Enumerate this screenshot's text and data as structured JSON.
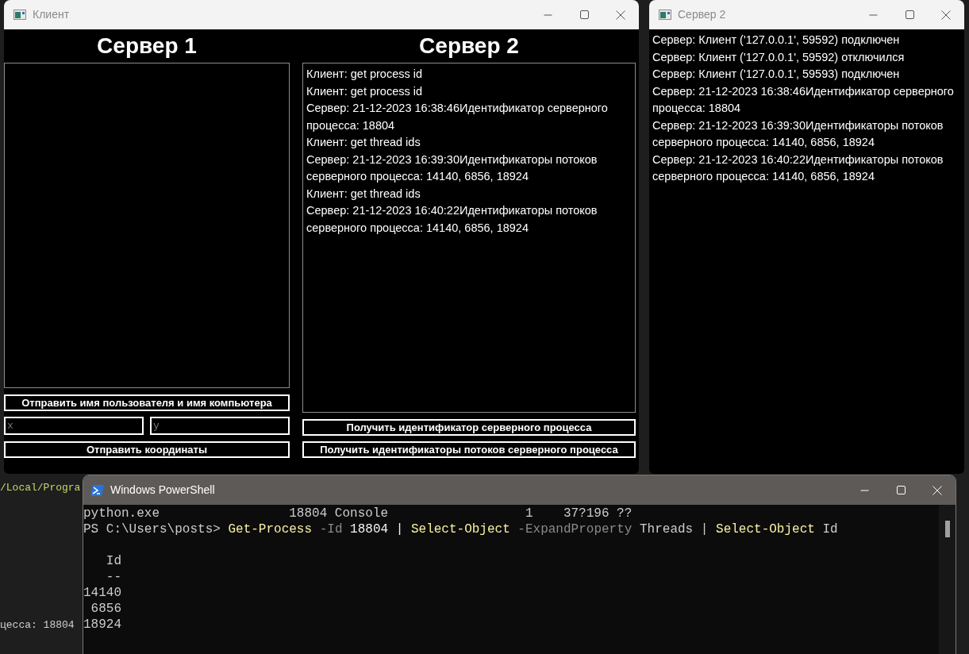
{
  "background_editor": {
    "lines": [
      {
        "text": "/Local/Progra",
        "kind": "path"
      },
      {
        "text": "цесса: 18804",
        "kind": "plain"
      }
    ]
  },
  "client_window": {
    "title": "Клиент",
    "server1": {
      "heading": "Сервер 1",
      "send_user_button": "Отправить имя пользователя и имя компьютера",
      "x_field": {
        "placeholder": "x"
      },
      "y_field": {
        "placeholder": "y"
      },
      "send_coords_button": "Отправить координаты"
    },
    "server2": {
      "heading": "Сервер 2",
      "log": [
        "Клиент: get process id",
        "Клиент: get process id",
        "Сервер: 21-12-2023 16:38:46Идентификатор серверного процесса: 18804",
        "Клиент: get thread ids",
        "Сервер: 21-12-2023 16:39:30Идентификаторы потоков серверного процесса: 14140, 6856, 18924",
        "Клиент: get thread ids",
        "Сервер: 21-12-2023 16:40:22Идентификаторы потоков серверного процесса: 14140, 6856, 18924"
      ],
      "buttons": [
        "Получить идентификатор серверного процесса",
        "Получить идентификаторы потоков серверного процесса"
      ]
    }
  },
  "server2_window": {
    "title": "Сервер 2",
    "log": [
      "Сервер: Клиент ('127.0.0.1', 59592) подключен",
      "Сервер: Клиент ('127.0.0.1', 59592) отключился",
      "Сервер: Клиент ('127.0.0.1', 59593) подключен",
      "Сервер: 21-12-2023 16:38:46Идентификатор серверного процесса: 18804",
      "Сервер: 21-12-2023 16:39:30Идентификаторы потоков серверного процесса: 14140, 6856, 18924",
      "Сервер: 21-12-2023 16:40:22Идентификаторы потоков серверного процесса: 14140, 6856, 18924"
    ]
  },
  "powershell": {
    "title": "Windows PowerShell",
    "lines": [
      {
        "segments": [
          {
            "kind": "text",
            "text": "python.exe                 18804 Console                  1    37?196 ??"
          }
        ]
      },
      {
        "segments": [
          {
            "kind": "text",
            "text": "PS C:\\Users\\posts>"
          },
          {
            "kind": "command",
            "text": "Get-Process"
          },
          {
            "kind": "param",
            "text": "-Id"
          },
          {
            "kind": "arg",
            "text": "18804 |"
          },
          {
            "kind": "command",
            "text": "Select-Object"
          },
          {
            "kind": "param",
            "text": "-ExpandProperty"
          },
          {
            "kind": "text",
            "text": "Threads |"
          },
          {
            "kind": "command",
            "text": "Select-Object"
          },
          {
            "kind": "text",
            "text": "Id"
          }
        ]
      },
      {
        "kind": "blank"
      },
      {
        "segments": [
          {
            "kind": "text",
            "text": "   Id"
          }
        ]
      },
      {
        "segments": [
          {
            "kind": "text",
            "text": "   --"
          }
        ]
      },
      {
        "segments": [
          {
            "kind": "text",
            "text": "14140"
          }
        ]
      },
      {
        "segments": [
          {
            "kind": "text",
            "text": " 6856"
          }
        ]
      },
      {
        "segments": [
          {
            "kind": "text",
            "text": "18924"
          }
        ]
      }
    ]
  }
}
